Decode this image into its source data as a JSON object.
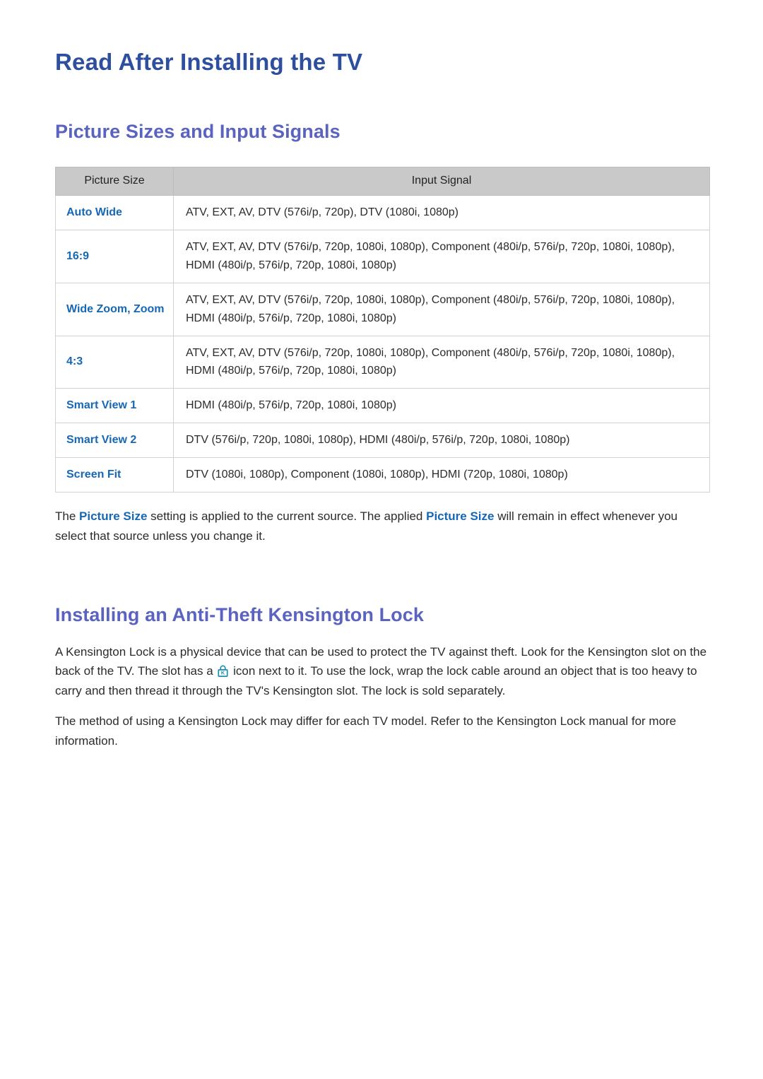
{
  "document": {
    "title": "Read After Installing the TV"
  },
  "sections": [
    {
      "heading": "Picture Sizes and Input Signals",
      "table": {
        "headers": [
          "Picture Size",
          "Input Signal"
        ],
        "rows": [
          {
            "size": "Auto Wide",
            "signal": "ATV, EXT, AV, DTV (576i/p, 720p), DTV (1080i, 1080p)"
          },
          {
            "size": "16:9",
            "signal": "ATV, EXT, AV, DTV (576i/p, 720p, 1080i, 1080p), Component (480i/p, 576i/p, 720p, 1080i, 1080p), HDMI (480i/p, 576i/p, 720p, 1080i, 1080p)"
          },
          {
            "size": "Wide Zoom, Zoom",
            "signal": "ATV, EXT, AV, DTV (576i/p, 720p, 1080i, 1080p), Component (480i/p, 576i/p, 720p, 1080i, 1080p), HDMI (480i/p, 576i/p, 720p, 1080i, 1080p)"
          },
          {
            "size": "4:3",
            "signal": "ATV, EXT, AV, DTV (576i/p, 720p, 1080i, 1080p), Component (480i/p, 576i/p, 720p, 1080i, 1080p), HDMI (480i/p, 576i/p, 720p, 1080i, 1080p)"
          },
          {
            "size": "Smart View 1",
            "signal": "HDMI (480i/p, 576i/p, 720p, 1080i, 1080p)"
          },
          {
            "size": "Smart View 2",
            "signal": "DTV (576i/p, 720p, 1080i, 1080p), HDMI (480i/p, 576i/p, 720p, 1080i, 1080p)"
          },
          {
            "size": "Screen Fit",
            "signal": "DTV (1080i, 1080p), Component (1080i, 1080p), HDMI (720p, 1080i, 1080p)"
          }
        ]
      },
      "note": {
        "part1": "The ",
        "term1": "Picture Size",
        "part2": " setting is applied to the current source. The applied ",
        "term2": "Picture Size",
        "part3": " will remain in effect whenever you select that source unless you change it."
      }
    },
    {
      "heading": "Installing an Anti-Theft Kensington Lock",
      "paragraph1": {
        "before_icon": "A Kensington Lock is a physical device that can be used to protect the TV against theft. Look for the Kensington slot on the back of the TV. The slot has a ",
        "icon": "kensington-lock-icon",
        "after_icon": " icon next to it. To use the lock, wrap the lock cable around an object that is too heavy to carry and then thread it through the TV's Kensington slot. The lock is sold separately."
      },
      "paragraph2": "The method of using a Kensington Lock may differ for each TV model. Refer to the Kensington Lock manual for more information."
    }
  ],
  "colors": {
    "title_blue": "#2d4f9e",
    "heading_blue": "#5a63c0",
    "link_blue": "#1667b5",
    "table_header_bg": "#c9c9c9",
    "body_text": "#2b2b2b",
    "lock_icon": "#1b8fae"
  }
}
